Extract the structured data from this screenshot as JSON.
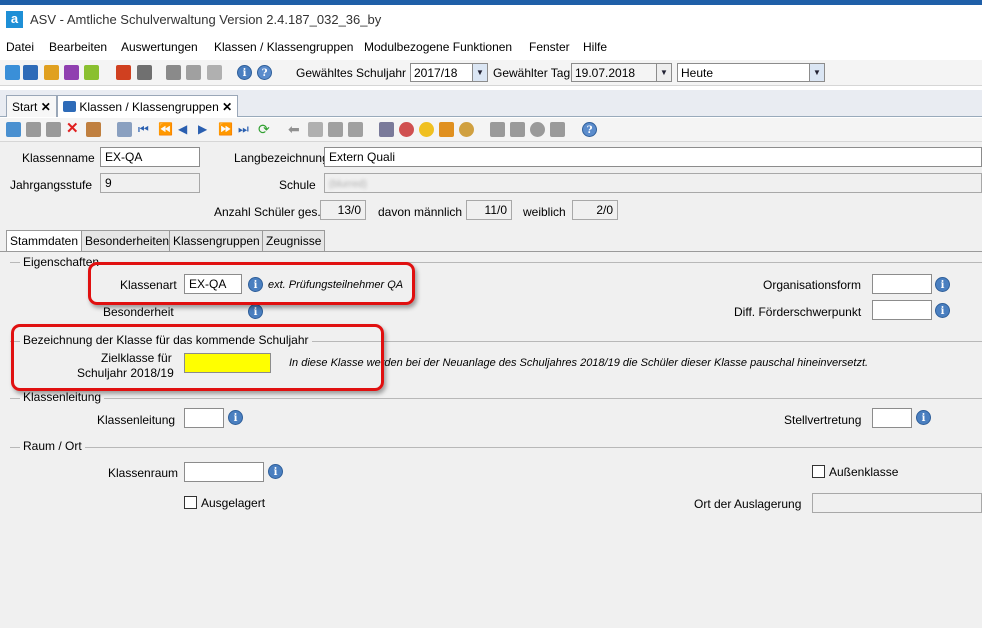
{
  "window": {
    "title": "ASV - Amtliche Schulverwaltung Version 2.4.187_032_36_by",
    "app_icon_letter": "a"
  },
  "menu": [
    "Datei",
    "Bearbeiten",
    "Auswertungen",
    "Klassen / Klassengruppen",
    "Modulbezogene Funktionen",
    "Fenster",
    "Hilfe"
  ],
  "toolbar": {
    "schuljahr_label": "Gewähltes Schuljahr",
    "schuljahr_value": "2017/18",
    "tag_label": "Gewählter Tag",
    "tag_value": "19.07.2018",
    "tag_preset": "Heute"
  },
  "tabs": [
    {
      "label": "Start",
      "close": "✕"
    },
    {
      "label": "Klassen / Klassengruppen",
      "close": "✕"
    }
  ],
  "header": {
    "klassenname_label": "Klassenname",
    "klassenname_value": "EX-QA",
    "langbezeichnung_label": "Langbezeichnung",
    "langbezeichnung_value": "Extern Quali",
    "jahrgangsstufe_label": "Jahrgangsstufe",
    "jahrgangsstufe_value": "9",
    "schule_label": "Schule",
    "schule_value": "(blurred)",
    "anzahl_label": "Anzahl Schüler ges.",
    "anzahl_value": "13/0",
    "maennlich_label": "davon männlich",
    "maennlich_value": "11/0",
    "weiblich_label": "weiblich",
    "weiblich_value": "2/0"
  },
  "subtabs": [
    "Stammdaten",
    "Besonderheiten",
    "Klassengruppen",
    "Zeugnisse"
  ],
  "eigenschaften": {
    "title": "Eigenschaften",
    "klassenart_label": "Klassenart",
    "klassenart_value": "EX-QA",
    "klassenart_hint": "ext. Prüfungsteilnehmer QA",
    "besonderheit_label": "Besonderheit",
    "organisationsform_label": "Organisationsform",
    "foerderschwerpunkt_label": "Diff. Förderschwerpunkt"
  },
  "kommendes_schuljahr": {
    "title": "Bezeichnung der Klasse für das kommende Schuljahr",
    "zielklasse_label_1": "Zielklasse für",
    "zielklasse_label_2": "Schuljahr 2018/19",
    "zielklasse_value": "",
    "hint": "In diese Klasse werden bei der Neuanlage des Schuljahres 2018/19 die Schüler dieser Klasse pauschal hineinversetzt.",
    "highlight_color": "#ffff00"
  },
  "klassenleitung": {
    "title": "Klassenleitung",
    "klassenleitung_label": "Klassenleitung",
    "stellvertretung_label": "Stellvertretung"
  },
  "raum": {
    "title": "Raum / Ort",
    "klassenraum_label": "Klassenraum",
    "aussenklasse_label": "Außenklasse",
    "ausgelagert_label": "Ausgelagert",
    "ort_label": "Ort der Auslagerung"
  },
  "colors": {
    "annotation_red": "#e01010",
    "info_blue": "#4a7fc0",
    "title_blue": "#1f5fa8"
  }
}
